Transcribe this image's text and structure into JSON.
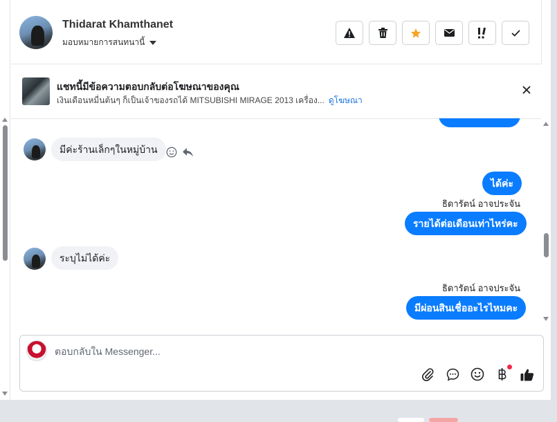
{
  "header": {
    "contact_name": "Thidarat Khamthanet",
    "assign_label": "มอบหมายการสนทนานี้",
    "actions": [
      {
        "name": "report-spam-button",
        "icon": "warning-icon"
      },
      {
        "name": "delete-button",
        "icon": "trash-icon"
      },
      {
        "name": "star-button",
        "icon": "star-icon"
      },
      {
        "name": "mark-unread-button",
        "icon": "envelope-icon"
      },
      {
        "name": "follow-up-button",
        "icon": "exclamation-icon"
      },
      {
        "name": "mark-done-button",
        "icon": "check-icon"
      }
    ]
  },
  "banner": {
    "title": "แชทนี้มีข้อความตอบกลับต่อโฆษณาของคุณ",
    "subtitle": "เงินเดือนหมื่นต้นๆ ก็เป็นเจ้าของรถได้ MITSUBISHI MIRAGE 2013 เครื่อง...",
    "link": "ดูโฆษณา"
  },
  "messages": {
    "m1": "มีค่ะร้านเล็กๆในหมู่บ้าน",
    "m2": "ได้ค่ะ",
    "m3_sender": "ธิดารัตน์ อาจประจัน",
    "m3": "รายได้ต่อเดือนเท่าไหร่คะ",
    "m4": "ระบุไม่ได้ค่ะ",
    "m5_sender": "ธิดารัตน์ อาจประจัน",
    "m5": "มีผ่อนสินเชื่ออะไรไหมคะ"
  },
  "composer": {
    "placeholder": "ตอบกลับใน Messenger..."
  },
  "colors": {
    "accent": "#0a7cff",
    "star": "#f5a623",
    "incoming_bubble": "#f0f2f5",
    "link": "#1b74e4"
  }
}
